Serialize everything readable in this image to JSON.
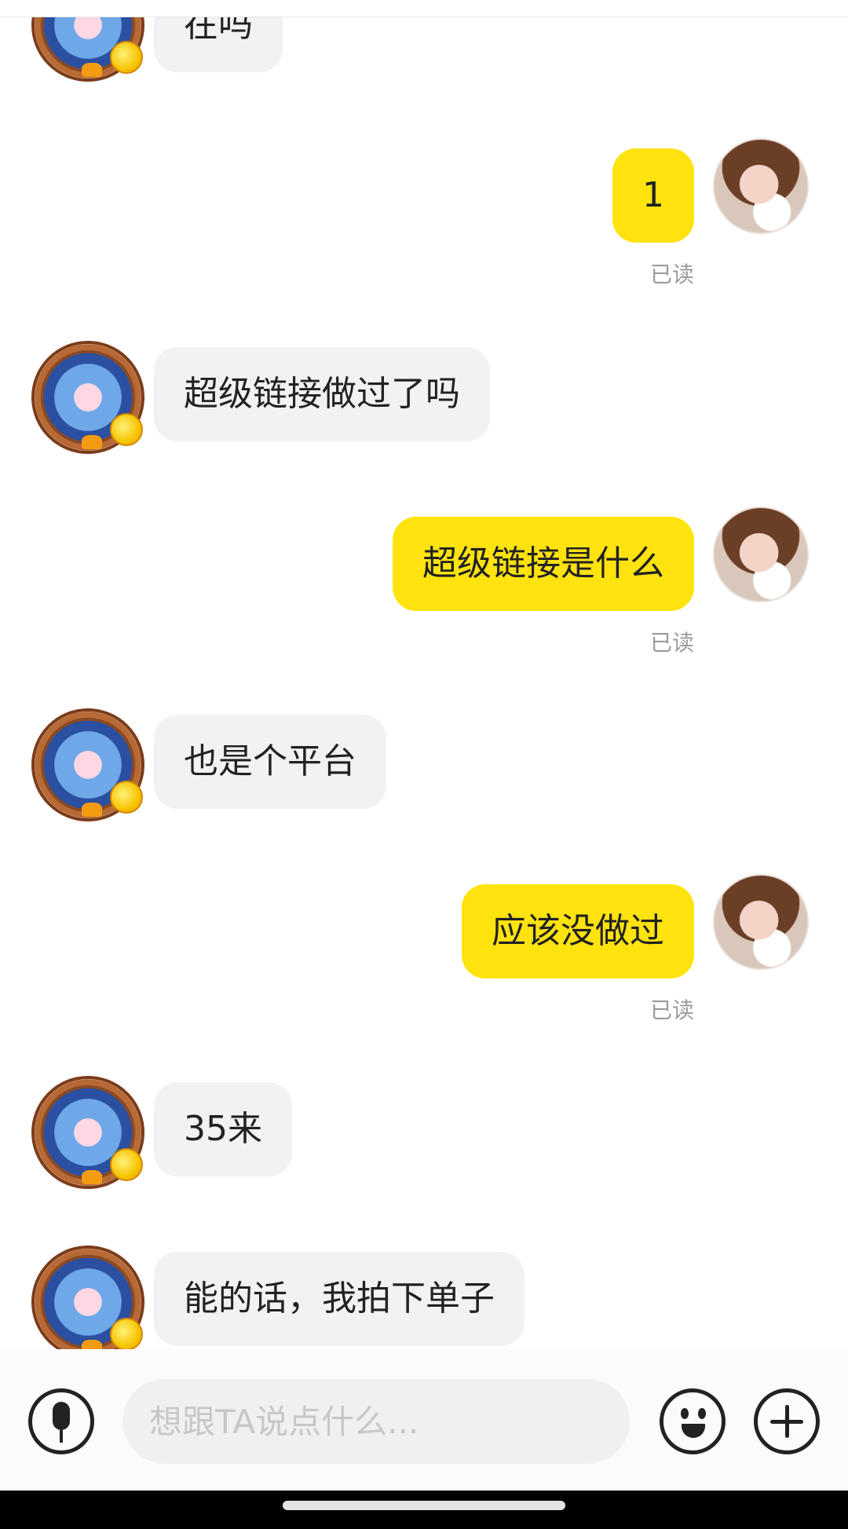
{
  "colors": {
    "self_bubble": "#ffe30f",
    "peer_bubble": "#f2f2f4",
    "read_text": "#9b9b9b",
    "background": "#ffffff",
    "nav_bar": "#000000"
  },
  "messages": [
    {
      "sender": "peer",
      "text": "在吗"
    },
    {
      "sender": "self",
      "text": "1",
      "status": "已读"
    },
    {
      "sender": "peer",
      "text": "超级链接做过了吗"
    },
    {
      "sender": "self",
      "text": "超级链接是什么",
      "status": "已读"
    },
    {
      "sender": "peer",
      "text": "也是个平台"
    },
    {
      "sender": "self",
      "text": "应该没做过",
      "status": "已读"
    },
    {
      "sender": "peer",
      "text": "35来"
    },
    {
      "sender": "peer",
      "text": "能的话，我拍下单子"
    }
  ],
  "composer": {
    "placeholder": "想跟TA说点什么...",
    "icons": [
      "mic-icon",
      "emoji-icon",
      "plus-icon"
    ]
  }
}
